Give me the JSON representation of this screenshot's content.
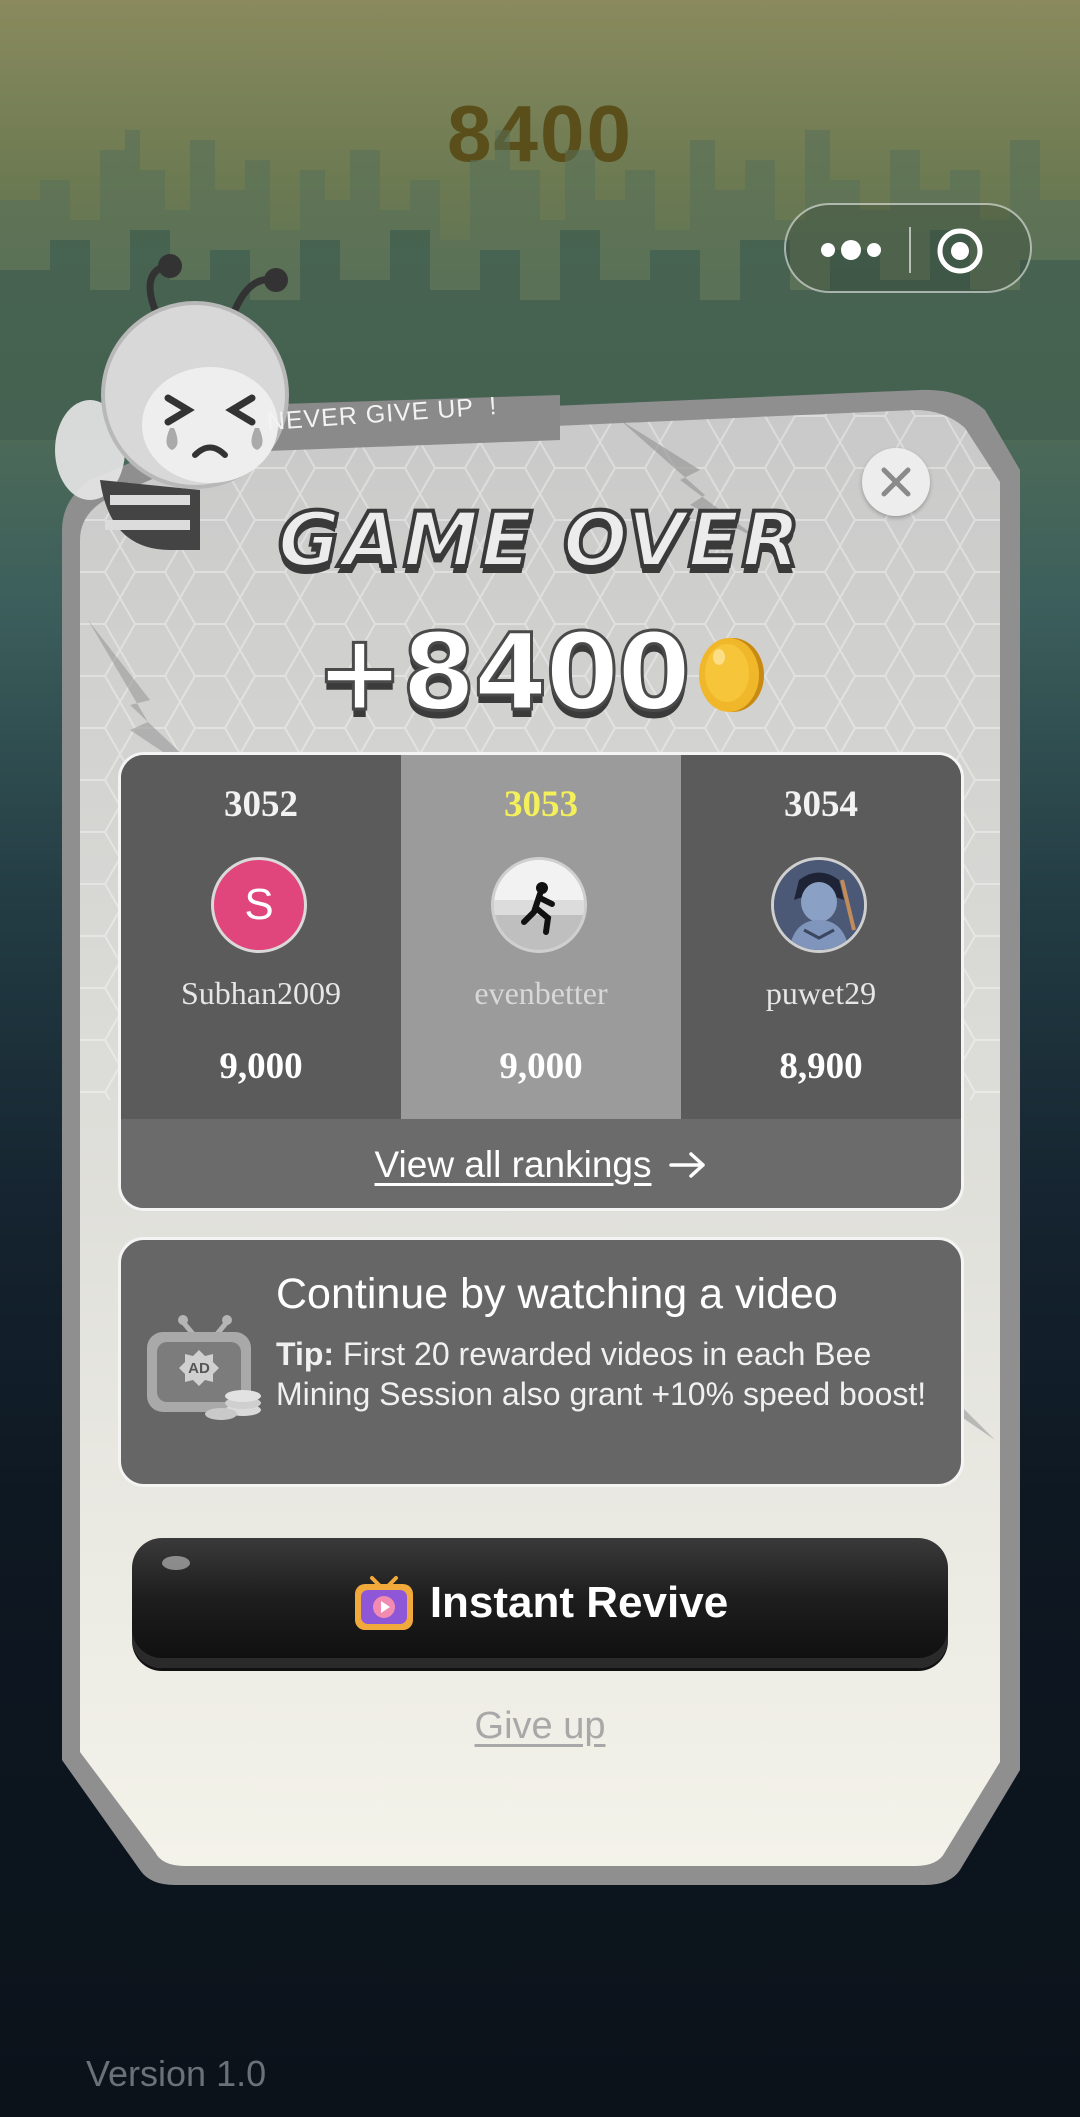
{
  "background": {
    "score": "8400"
  },
  "capsule": {
    "more_icon": "more-dots-icon",
    "close_icon": "target-circle-icon"
  },
  "panel": {
    "banner": "NEVER GIVE UP  !",
    "title": "GAME OVER",
    "earned_score": "+8400",
    "coin_icon": "gold-coin-icon"
  },
  "leaderboard": {
    "entries": [
      {
        "rank": "3052",
        "name": "Subhan2009",
        "score": "9,000",
        "avatar_letter": "S",
        "avatar_color": "#e0457b",
        "is_self": false
      },
      {
        "rank": "3053",
        "name": "evenbetter",
        "score": "9,000",
        "avatar_letter": "",
        "is_self": true
      },
      {
        "rank": "3054",
        "name": "puwet29",
        "score": "8,900",
        "avatar_letter": "",
        "is_self": false
      }
    ],
    "view_all_label": "View all rankings"
  },
  "video_offer": {
    "title": "Continue by watching a video",
    "tip_label": "Tip:",
    "tip_text": " First 20 rewarded videos in each Bee Mining Session also grant +10% speed boost!",
    "icon_text": "AD"
  },
  "revive_button": {
    "label": "Instant Revive"
  },
  "give_up_label": "Give up",
  "version": "Version 1.0",
  "colors": {
    "self_rank": "#f4f05a",
    "panel_bg": "#e6e6e2",
    "panel_border": "#8e8e8e",
    "coin": "#f1b72a"
  }
}
